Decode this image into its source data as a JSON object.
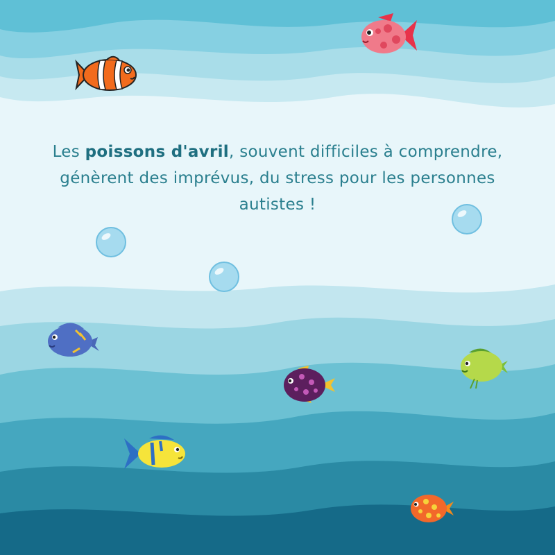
{
  "message": {
    "before": "Les ",
    "highlight": "poissons d'avril",
    "after": ", souvent difficiles à comprendre, génèrent des imprévus, du stress pour les personnes autistes !"
  },
  "colors": {
    "wave_top_1": "#5fc0d6",
    "wave_top_2": "#86d0e2",
    "wave_top_3": "#a9dde9",
    "wave_top_4": "#c7e9f1",
    "background": "#e8f6fa",
    "wave_bottom_1": "#c2e6ef",
    "wave_bottom_2": "#9bd6e3",
    "wave_bottom_3": "#6cc1d3",
    "wave_bottom_4": "#45a7bf",
    "wave_bottom_5": "#2a8aa4",
    "wave_bottom_6": "#156a88",
    "text": "#2a7f8e"
  },
  "fish": [
    {
      "name": "pink-spotted-fish-icon"
    },
    {
      "name": "clownfish-icon"
    },
    {
      "name": "blue-fish-icon"
    },
    {
      "name": "purple-spotted-fish-icon"
    },
    {
      "name": "green-fish-icon"
    },
    {
      "name": "yellow-blue-fish-icon"
    },
    {
      "name": "orange-spotted-fish-icon"
    }
  ],
  "bubbles": [
    {
      "name": "bubble-icon"
    },
    {
      "name": "bubble-icon"
    },
    {
      "name": "bubble-icon"
    }
  ]
}
